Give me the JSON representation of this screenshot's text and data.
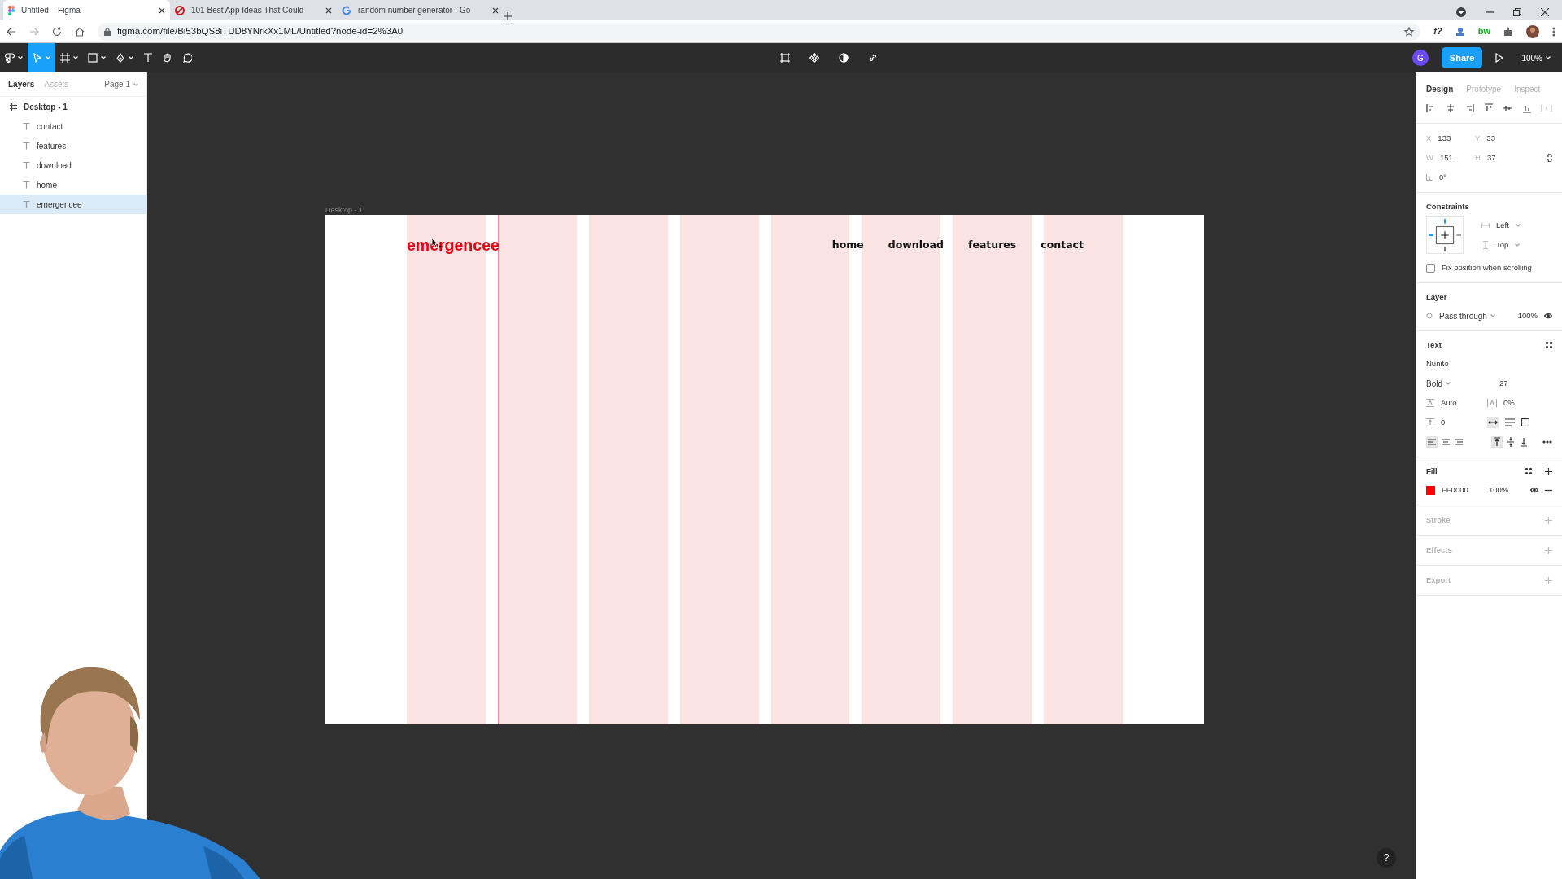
{
  "browser": {
    "tabs": [
      {
        "title": "Untitled – Figma",
        "kind": "figma",
        "selected": true
      },
      {
        "title": "101 Best App Ideas That Could",
        "kind": "blocked",
        "selected": false
      },
      {
        "title": "random number generator - Go",
        "kind": "google",
        "selected": false
      }
    ],
    "url": "figma.com/file/Bi53bQS8iTUD8YNrkXx1ML/Untitled?node-id=2%3A0",
    "extension_text": "f?",
    "extension_text_2": "bw"
  },
  "toolbar": {
    "tools": [
      {
        "kind": "menu",
        "selected": false
      },
      {
        "kind": "move",
        "selected": true
      },
      {
        "kind": "frame",
        "selected": false
      },
      {
        "kind": "shape",
        "selected": false
      },
      {
        "kind": "pen",
        "selected": false
      },
      {
        "kind": "text",
        "selected": false
      },
      {
        "kind": "hand",
        "selected": false
      },
      {
        "kind": "comment",
        "selected": false
      }
    ],
    "avatar": "G",
    "share": "Share",
    "zoom": "100%"
  },
  "layers_panel": {
    "tabs": [
      {
        "label": "Layers",
        "selected": true
      },
      {
        "label": "Assets",
        "selected": false
      }
    ],
    "page": "Page 1",
    "layers": [
      {
        "name": "Desktop - 1",
        "kind": "frame",
        "selected": false,
        "children": [
          {
            "name": "contact",
            "kind": "text",
            "selected": false
          },
          {
            "name": "features",
            "kind": "text",
            "selected": false
          },
          {
            "name": "download",
            "kind": "text",
            "selected": false
          },
          {
            "name": "home",
            "kind": "text",
            "selected": false
          },
          {
            "name": "emergencee",
            "kind": "text",
            "selected": true
          }
        ]
      }
    ]
  },
  "canvas": {
    "frame_label": "Desktop - 1",
    "logo": "emergencee",
    "nav": [
      "home",
      "download",
      "features",
      "contact"
    ]
  },
  "design_panel": {
    "tabs": [
      {
        "label": "Design",
        "selected": true
      },
      {
        "label": "Prototype",
        "selected": false
      },
      {
        "label": "Inspect",
        "selected": false
      }
    ],
    "position": [
      {
        "label": "X",
        "value": "133"
      },
      {
        "label": "Y",
        "value": "33"
      },
      {
        "label": "W",
        "value": "151"
      },
      {
        "label": "H",
        "value": "37"
      }
    ],
    "rotation": "0°",
    "constraints": {
      "title": "Constraints",
      "horizontal": "Left",
      "vertical": "Top",
      "fix_label": "Fix position when scrolling",
      "fix_checked": false
    },
    "layer": {
      "title": "Layer",
      "blend": "Pass through",
      "opacity": "100%"
    },
    "text": {
      "title": "Text",
      "font": "Nunito",
      "weight": "Bold",
      "size": "27",
      "line_height": "Auto",
      "letter_spacing": "0%",
      "paragraph_spacing": "0"
    },
    "fill": {
      "title": "Fill",
      "hex": "FF0000",
      "opacity": "100%",
      "color": "#ff0000"
    },
    "sections": [
      "Stroke",
      "Effects",
      "Export"
    ]
  },
  "help": "?"
}
